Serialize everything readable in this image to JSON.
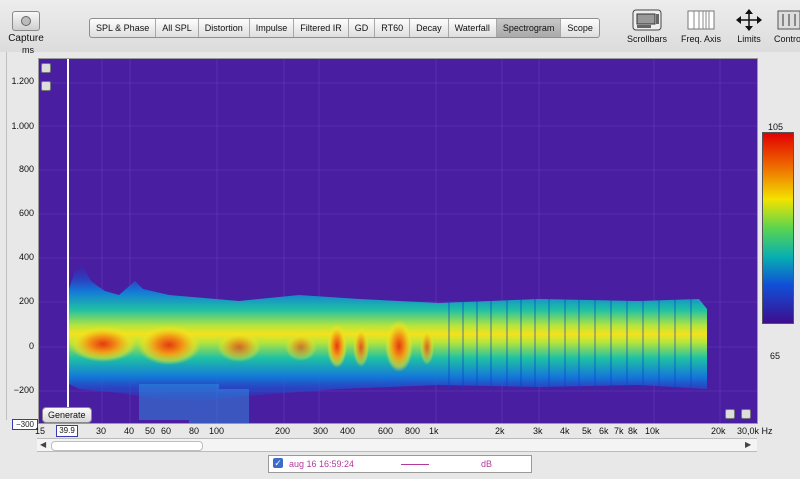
{
  "toolbar": {
    "capture": "Capture",
    "tabs": [
      "SPL & Phase",
      "All SPL",
      "Distortion",
      "Impulse",
      "Filtered IR",
      "GD",
      "RT60",
      "Decay",
      "Waterfall",
      "Spectrogram",
      "Scope"
    ],
    "active_tab": "Spectrogram",
    "tools": [
      {
        "label": "Scrollbars",
        "icon": "scrollbars-icon"
      },
      {
        "label": "Freq. Axis",
        "icon": "freq-axis-icon"
      },
      {
        "label": "Limits",
        "icon": "limits-icon"
      },
      {
        "label": "Contro",
        "icon": "controls-icon"
      }
    ]
  },
  "y_axis": {
    "unit": "ms",
    "ticks": [
      "1.200",
      "1.000",
      "800",
      "600",
      "400",
      "200",
      "0",
      "−200"
    ],
    "min_value": "−300"
  },
  "x_axis": {
    "start_label": "15",
    "cursor_value": "39.9",
    "ticks": [
      "30",
      "40",
      "50",
      "60",
      "80",
      "100",
      "200",
      "300",
      "400",
      "600",
      "800",
      "1k",
      "2k",
      "3k",
      "4k",
      "5k",
      "6k",
      "7k",
      "8k",
      "10k",
      "20k",
      "30,0k Hz"
    ]
  },
  "plot": {
    "generate_label": "Generate",
    "background_color": "#4a1ea0"
  },
  "color_scale": {
    "max": "105",
    "min": "65"
  },
  "legend": {
    "checked": true,
    "measurement": "aug 16 16:59:24",
    "unit": "dB",
    "line_color": "#b33a9c"
  }
}
